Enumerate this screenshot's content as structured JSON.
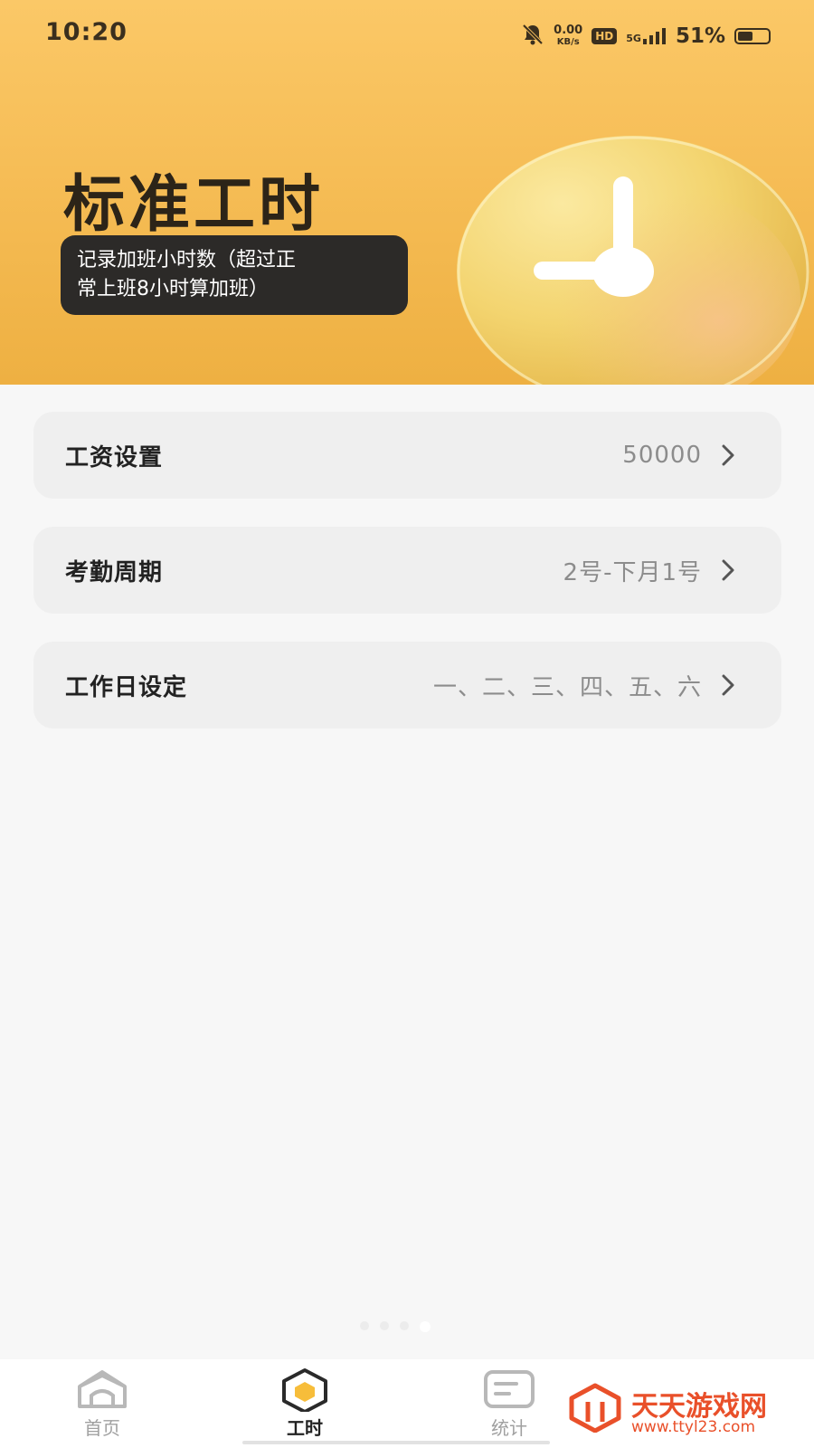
{
  "status_bar": {
    "time": "10:20",
    "net_speed_value": "0.00",
    "net_speed_unit": "KB/s",
    "hd": "HD",
    "network": "5G",
    "battery_percent": "51%",
    "battery_level": 0.51
  },
  "header": {
    "title": "标准工时",
    "subtitle_line1": "记录加班小时数（超过正",
    "subtitle_line2": "常上班8小时算加班）",
    "background_color": "#f6bd56"
  },
  "settings": [
    {
      "label": "工资设置",
      "value": "50000"
    },
    {
      "label": "考勤周期",
      "value": "2号-下月1号"
    },
    {
      "label": "工作日设定",
      "value": "一、二、三、四、五、六"
    }
  ],
  "page_indicator": {
    "count": 4,
    "active_index": 3
  },
  "bottom_nav": {
    "items": [
      {
        "label": "首页",
        "icon": "home-icon"
      },
      {
        "label": "工时",
        "icon": "hexagon-icon",
        "active": true
      },
      {
        "label": "统计",
        "icon": "stats-icon"
      }
    ]
  },
  "watermark": {
    "name": "天天游戏网",
    "url": "www.ttyl23.com"
  }
}
